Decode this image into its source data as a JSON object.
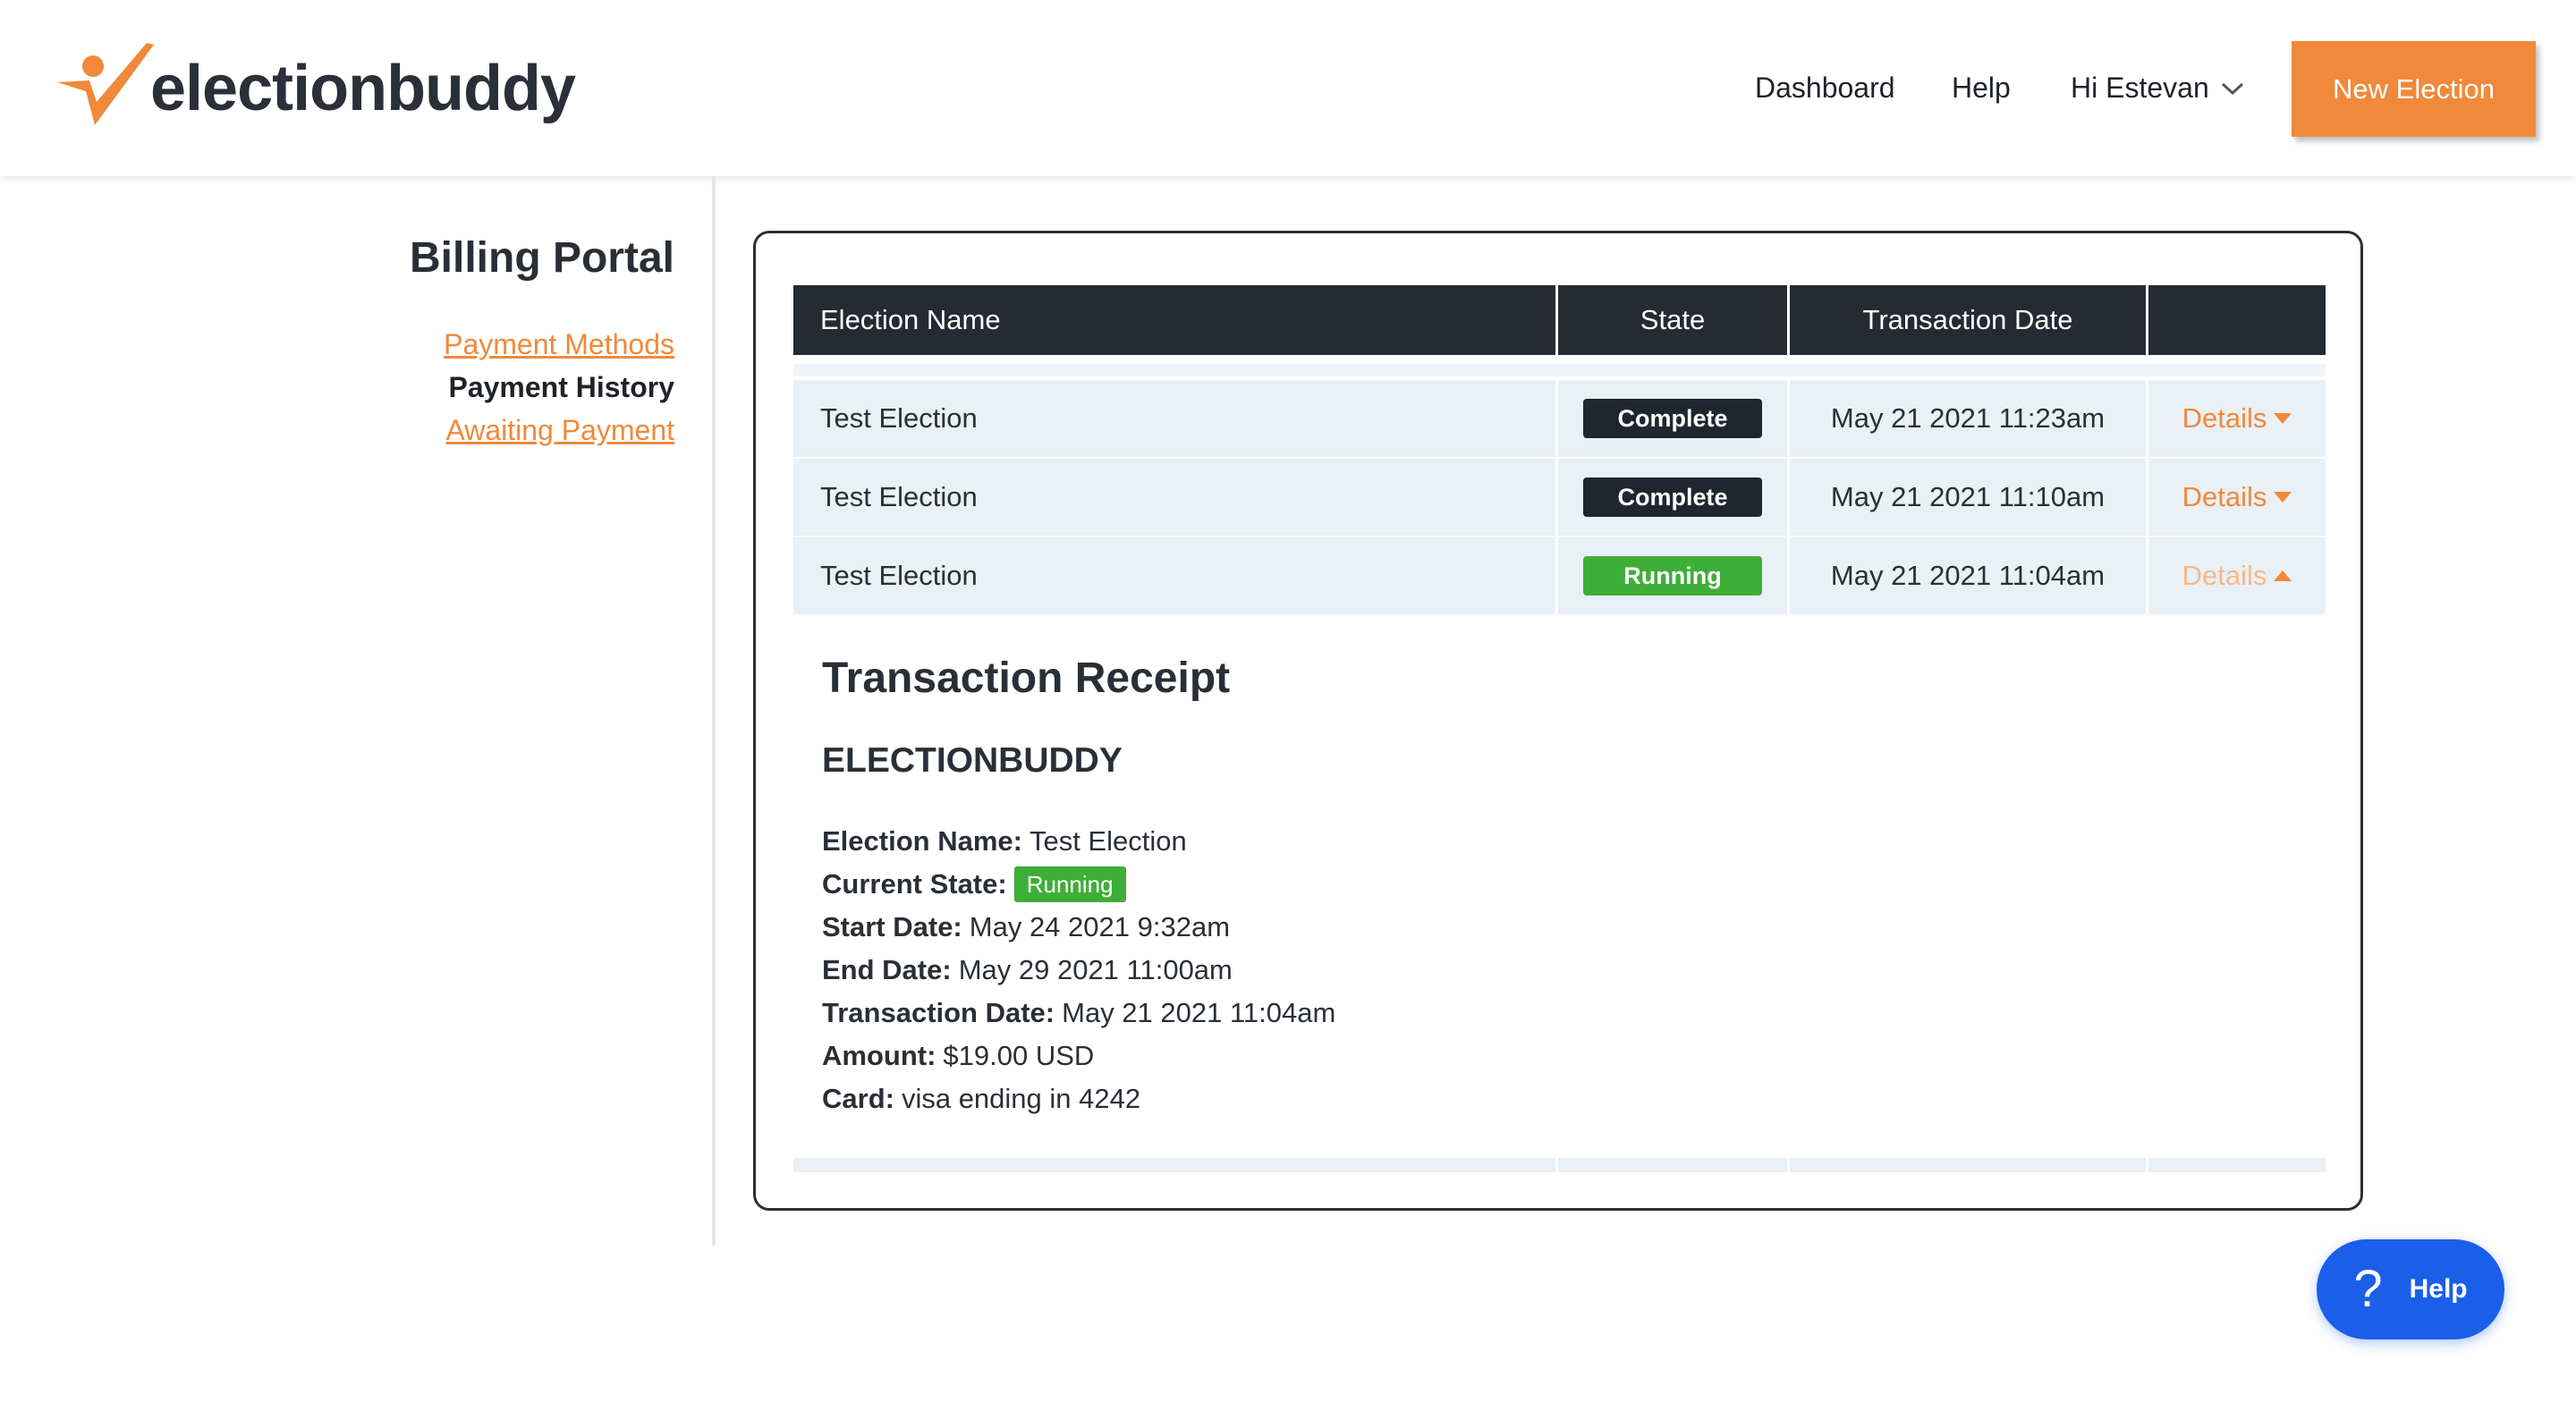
{
  "header": {
    "logo_text": "electionbuddy",
    "nav": {
      "dashboard": "Dashboard",
      "help": "Help",
      "user_greeting": "Hi Estevan"
    },
    "new_election_label": "New Election",
    "accent_color": "#f0893a"
  },
  "sidebar": {
    "title": "Billing Portal",
    "items": [
      {
        "label": "Payment Methods",
        "active": false
      },
      {
        "label": "Payment History",
        "active": true
      },
      {
        "label": "Awaiting Payment",
        "active": false
      }
    ]
  },
  "table": {
    "columns": [
      "Election Name",
      "State",
      "Transaction Date",
      ""
    ],
    "rows": [
      {
        "name": "Test Election",
        "state": "Complete",
        "date": "May 21 2021 11:23am",
        "action": "Details"
      },
      {
        "name": "Test Election",
        "state": "Complete",
        "date": "May 21 2021 11:10am",
        "action": "Details"
      },
      {
        "name": "Test Election",
        "state": "Running",
        "date": "May 21 2021 11:04am",
        "action": "Details"
      }
    ]
  },
  "receipt": {
    "title": "Transaction Receipt",
    "org": "ELECTIONBUDDY",
    "fields": {
      "election_name": {
        "label": "Election Name:",
        "value": "Test Election"
      },
      "current_state": {
        "label": "Current State:",
        "value": "Running"
      },
      "start_date": {
        "label": "Start Date:",
        "value": "May 24 2021 9:32am"
      },
      "end_date": {
        "label": "End Date:",
        "value": "May 29 2021 11:00am"
      },
      "transaction_date": {
        "label": "Transaction Date:",
        "value": "May 21 2021 11:04am"
      },
      "amount": {
        "label": "Amount:",
        "value": "$19.00 USD"
      },
      "card": {
        "label": "Card:",
        "value": "visa ending in 4242"
      }
    }
  },
  "help_widget": {
    "icon": "question-icon",
    "label": "Help"
  }
}
